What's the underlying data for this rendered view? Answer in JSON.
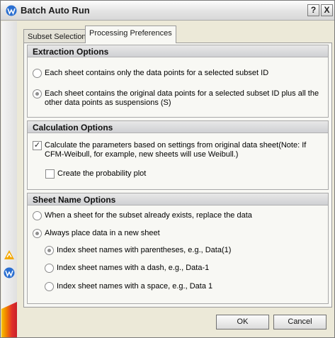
{
  "window": {
    "title": "Batch Auto Run",
    "help_label": "?",
    "close_label": "X"
  },
  "tabs": [
    {
      "label": "Subset Selection",
      "active": false
    },
    {
      "label": "Processing Preferences",
      "active": true
    }
  ],
  "extraction": {
    "header": "Extraction Options",
    "options": [
      {
        "label": "Each sheet contains only the data points for a selected subset ID",
        "selected": false
      },
      {
        "label": "Each sheet contains the original data points for a selected subset ID plus all the other data points as suspensions (S)",
        "selected": true
      }
    ]
  },
  "calculation": {
    "header": "Calculation Options",
    "calc_params": {
      "label": "Calculate the parameters based on settings from original data sheet(Note: If CFM-Weibull, for example, new sheets will use Weibull.)",
      "checked": true,
      "mark": "✓"
    },
    "prob_plot": {
      "label": "Create the probability plot",
      "checked": false
    }
  },
  "sheetname": {
    "header": "Sheet Name Options",
    "replace": {
      "label": "When a sheet for the subset already exists, replace the data",
      "selected": false
    },
    "new_sheet": {
      "label": "Always place data in a new sheet",
      "selected": true
    },
    "naming": [
      {
        "label": "Index sheet names with parentheses, e.g., Data(1)",
        "selected": true
      },
      {
        "label": "Index sheet names with a dash, e.g., Data-1",
        "selected": false
      },
      {
        "label": "Index sheet names with a space, e.g., Data 1",
        "selected": false
      }
    ]
  },
  "buttons": {
    "ok": "OK",
    "cancel": "Cancel"
  },
  "colors": {
    "accent_orange": "#f4a900",
    "accent_blue": "#2a6fd1"
  },
  "icons": {
    "app": "weibull-app-icon",
    "strip_top": "alert-app-icon",
    "strip_bottom": "weibull-small-icon"
  }
}
